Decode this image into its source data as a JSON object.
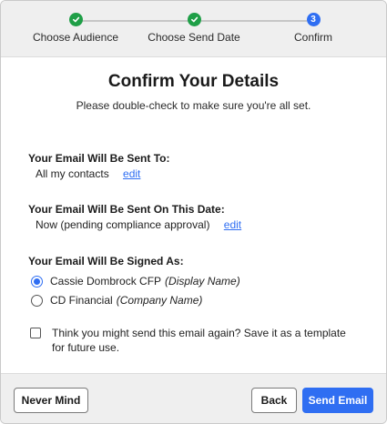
{
  "stepper": {
    "steps": [
      {
        "label": "Choose Audience",
        "status": "complete",
        "icon": "check-icon"
      },
      {
        "label": "Choose Send Date",
        "status": "complete",
        "icon": "check-icon"
      },
      {
        "label": "Confirm",
        "status": "current",
        "number": "3"
      }
    ]
  },
  "header": {
    "title": "Confirm Your Details",
    "subtitle": "Please double-check to make sure you're all set."
  },
  "recipients": {
    "heading": "Your Email Will Be Sent To:",
    "value": "All my contacts",
    "edit_label": "edit"
  },
  "send_date": {
    "heading": "Your Email Will Be Sent On This Date:",
    "value": "Now (pending compliance approval)",
    "edit_label": "edit"
  },
  "signature": {
    "heading": "Your Email Will Be Signed As:",
    "options": [
      {
        "name": "Cassie Dombrock CFP",
        "note": "(Display Name)",
        "selected": true
      },
      {
        "name": "CD Financial",
        "note": "(Company Name)",
        "selected": false
      }
    ]
  },
  "template_option": {
    "label": "Think you might send this email again? Save it as a template for future use.",
    "checked": false
  },
  "footer": {
    "never_mind_label": "Never Mind",
    "back_label": "Back",
    "send_label": "Send Email"
  },
  "colors": {
    "accent": "#2f6ef2",
    "success": "#1f9f47"
  }
}
